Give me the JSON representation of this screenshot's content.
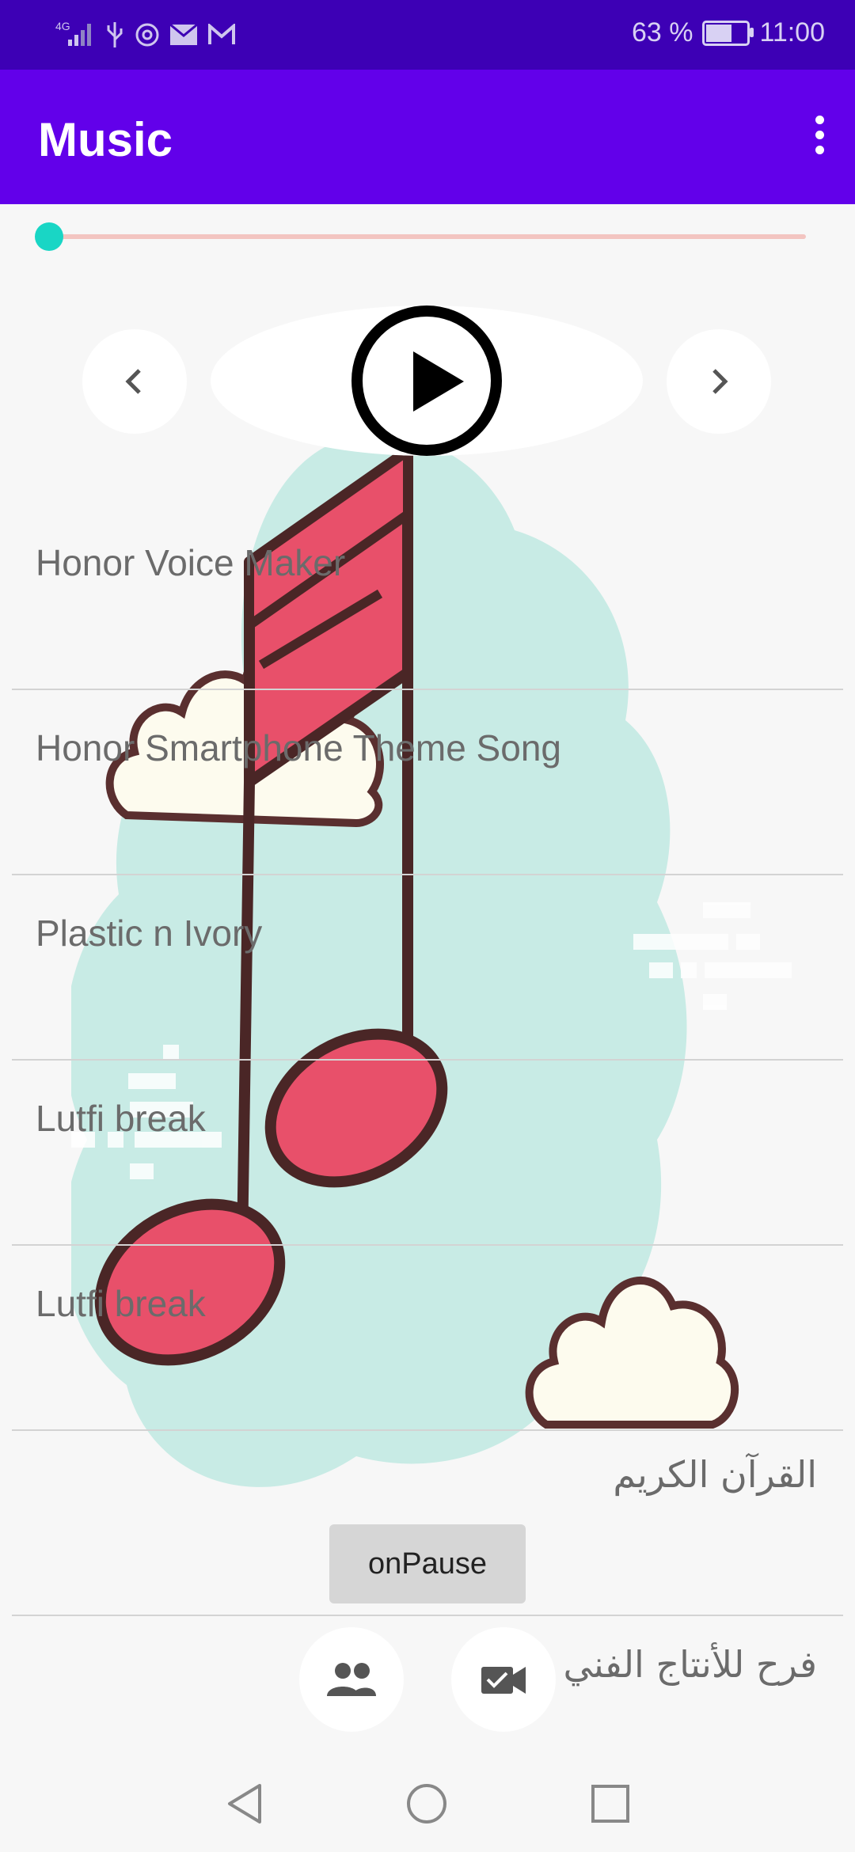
{
  "status_bar": {
    "network": "4G",
    "battery_percent_text": "63 %",
    "battery_level": 0.63,
    "time": "11:00"
  },
  "app_bar": {
    "title": "Music",
    "menu_icon": "more-vert-icon"
  },
  "player": {
    "progress": 0.0,
    "prev_icon": "chevron-left-icon",
    "play_icon": "play-icon",
    "next_icon": "chevron-right-icon"
  },
  "songs": [
    {
      "title": "Honor Voice Maker"
    },
    {
      "title": "Honor Smartphone Theme Song"
    },
    {
      "title": "Plastic n Ivory"
    },
    {
      "title": "Lutfi break"
    },
    {
      "title": "Lutfi break"
    }
  ],
  "extra": {
    "quran_label": "القرآن الكريم",
    "pause_button": "onPause",
    "production_label": "فرح للأنتاج الفني",
    "contacts_icon": "people-icon",
    "video_icon": "video-call-icon"
  },
  "colors": {
    "status_bar": "#3d00b5",
    "app_bar": "#6200ea",
    "seek_thumb": "#19d6c5",
    "note": "#e8506a",
    "cloud_bg": "#c8ebe5"
  }
}
